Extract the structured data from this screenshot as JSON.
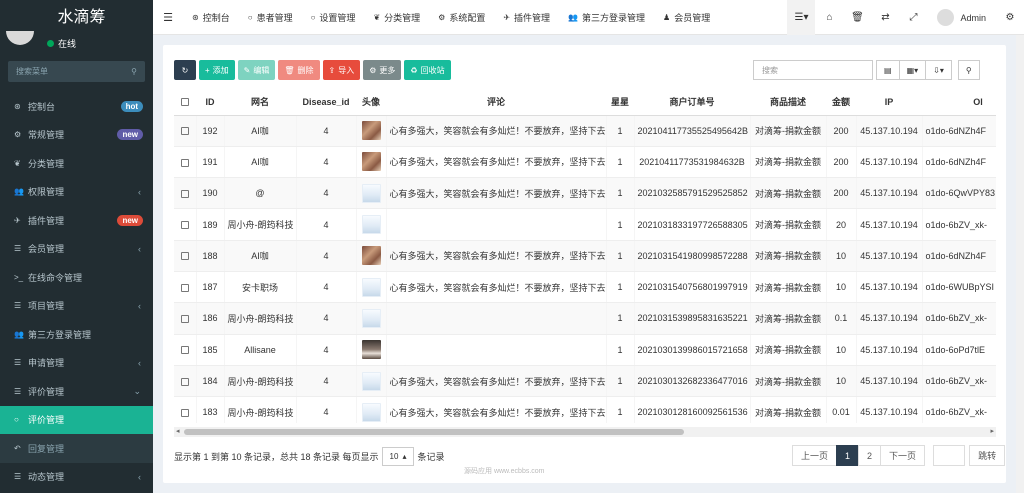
{
  "sidebar": {
    "brand": "水滴筹",
    "status": "在线",
    "search_placeholder": "搜索菜单",
    "items": [
      {
        "label": "控制台",
        "icon": "dashboard-icon",
        "badge": "hot",
        "badge_color": "#3c8dbc"
      },
      {
        "label": "常规管理",
        "icon": "cogs-icon",
        "badge": "new",
        "badge_color": "#605ca8"
      },
      {
        "label": "分类管理",
        "icon": "leaf-icon"
      },
      {
        "label": "权限管理",
        "icon": "group-icon",
        "arrow": "‹"
      },
      {
        "label": "插件管理",
        "icon": "rocket-icon",
        "badge": "new",
        "badge_color": "#dd4b39"
      },
      {
        "label": "会员管理",
        "icon": "list-icon",
        "arrow": "‹"
      },
      {
        "label": "在线命令管理",
        "icon": "terminal-icon"
      },
      {
        "label": "项目管理",
        "icon": "list-icon",
        "arrow": "‹"
      },
      {
        "label": "第三方登录管理",
        "icon": "users-icon"
      },
      {
        "label": "申请管理",
        "icon": "list-icon",
        "arrow": "‹"
      },
      {
        "label": "评价管理",
        "icon": "list-icon",
        "arrow": "⌄"
      },
      {
        "label": "评价管理",
        "icon": "circle-icon",
        "active": true
      },
      {
        "label": "回复管理",
        "icon": "reply-icon",
        "sub": true
      },
      {
        "label": "动态管理",
        "icon": "list-icon",
        "arrow": "‹"
      }
    ]
  },
  "topnav": {
    "items": [
      {
        "label": "控制台",
        "icon": "dashboard-icon"
      },
      {
        "label": "患者管理",
        "icon": "circle-icon"
      },
      {
        "label": "设置管理",
        "icon": "circle-icon"
      },
      {
        "label": "分类管理",
        "icon": "leaf-icon"
      },
      {
        "label": "系统配置",
        "icon": "gear-icon"
      },
      {
        "label": "插件管理",
        "icon": "rocket-icon"
      },
      {
        "label": "第三方登录管理",
        "icon": "users-icon"
      },
      {
        "label": "会员管理",
        "icon": "user-icon"
      }
    ],
    "admin": "Admin"
  },
  "toolbar": {
    "add": "添加",
    "edit": "编辑",
    "delete": "删除",
    "import": "导入",
    "more": "更多",
    "recycle": "回收站",
    "search_placeholder": "搜索"
  },
  "table": {
    "headers": [
      "ID",
      "网名",
      "Disease_id",
      "头像",
      "评论",
      "星星",
      "商户订单号",
      "商品描述",
      "金额",
      "IP",
      "Ol"
    ],
    "rows": [
      {
        "id": "192",
        "name": "AI咖",
        "disease": "4",
        "avatar": "a",
        "comment": "心有多强大，笑容就会有多灿烂！不要放弃，坚持下去",
        "star": "1",
        "order": "202104117735525495642B",
        "desc": "对滴筹-捐款金额",
        "amount": "200",
        "ip": "45.137.10.194",
        "openid": "o1do-6dNZh4F"
      },
      {
        "id": "191",
        "name": "AI咖",
        "disease": "4",
        "avatar": "a",
        "comment": "心有多强大，笑容就会有多灿烂！不要放弃，坚持下去",
        "star": "1",
        "order": "20210411773531984632B",
        "desc": "对滴筹-捐款金额",
        "amount": "200",
        "ip": "45.137.10.194",
        "openid": "o1do-6dNZh4F"
      },
      {
        "id": "190",
        "name": "@",
        "disease": "4",
        "avatar": "b",
        "comment": "心有多强大，笑容就会有多灿烂！不要放弃，坚持下去",
        "star": "1",
        "order": "2021032585791529525852",
        "desc": "对滴筹-捐款金额",
        "amount": "200",
        "ip": "45.137.10.194",
        "openid": "o1do-6QwVPY83"
      },
      {
        "id": "189",
        "name": "周小舟-朗筠科技",
        "disease": "4",
        "avatar": "b",
        "comment": "",
        "star": "1",
        "order": "2021031833197726588305",
        "desc": "对滴筹-捐款金额",
        "amount": "20",
        "ip": "45.137.10.194",
        "openid": "o1do-6bZV_xk-"
      },
      {
        "id": "188",
        "name": "AI咖",
        "disease": "4",
        "avatar": "a",
        "comment": "心有多强大，笑容就会有多灿烂！不要放弃，坚持下去",
        "star": "1",
        "order": "2021031541980998572288",
        "desc": "对滴筹-捐款金额",
        "amount": "10",
        "ip": "45.137.10.194",
        "openid": "o1do-6dNZh4F"
      },
      {
        "id": "187",
        "name": "安卡职场",
        "disease": "4",
        "avatar": "b",
        "comment": "心有多强大，笑容就会有多灿烂！不要放弃，坚持下去",
        "star": "1",
        "order": "2021031540756801997919",
        "desc": "对滴筹-捐款金额",
        "amount": "10",
        "ip": "45.137.10.194",
        "openid": "o1do-6WUBpYSI"
      },
      {
        "id": "186",
        "name": "周小舟-朗筠科技",
        "disease": "4",
        "avatar": "b",
        "comment": "",
        "star": "1",
        "order": "2021031539895831635221",
        "desc": "对滴筹-捐款金额",
        "amount": "0.1",
        "ip": "45.137.10.194",
        "openid": "o1do-6bZV_xk-"
      },
      {
        "id": "185",
        "name": "Allisane",
        "disease": "4",
        "avatar": "c",
        "comment": "",
        "star": "1",
        "order": "2021030139986015721658",
        "desc": "对滴筹-捐款金额",
        "amount": "10",
        "ip": "45.137.10.194",
        "openid": "o1do-6oPd7tlE"
      },
      {
        "id": "184",
        "name": "周小舟-朗筠科技",
        "disease": "4",
        "avatar": "b",
        "comment": "心有多强大，笑容就会有多灿烂！不要放弃，坚持下去",
        "star": "1",
        "order": "2021030132682336477016",
        "desc": "对滴筹-捐款金额",
        "amount": "10",
        "ip": "45.137.10.194",
        "openid": "o1do-6bZV_xk-"
      },
      {
        "id": "183",
        "name": "周小舟-朗筠科技",
        "disease": "4",
        "avatar": "b",
        "comment": "心有多强大，笑容就会有多灿烂！不要放弃，坚持下去",
        "star": "1",
        "order": "2021030128160092561536",
        "desc": "对滴筹-捐款金额",
        "amount": "0.01",
        "ip": "45.137.10.194",
        "openid": "o1do-6bZV_xk-"
      }
    ]
  },
  "footer": {
    "summary": "显示第 1 到第 10 条记录，总共 18 条记录 每页显示",
    "page_size": "10",
    "suffix": "条记录"
  },
  "pager": {
    "prev": "上一页",
    "pages": [
      "1",
      "2"
    ],
    "next": "下一页",
    "go": "跳转"
  },
  "watermark": "源码应用 www.ecbbs.com"
}
